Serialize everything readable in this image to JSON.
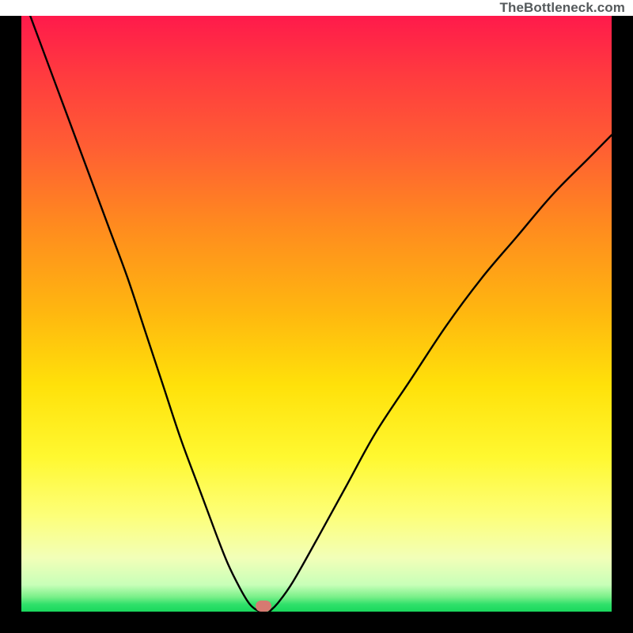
{
  "watermark": "TheBottleneck.com",
  "colors": {
    "frame": "#000000",
    "curve": "#000000",
    "marker": "#d67a71"
  },
  "chart_data": {
    "type": "line",
    "title": "",
    "xlabel": "",
    "ylabel": "",
    "xlim": [
      0,
      100
    ],
    "ylim": [
      0,
      100
    ],
    "grid": false,
    "legend": false,
    "series": [
      {
        "name": "bottleneck-curve-left",
        "x": [
          0,
          3,
          6,
          9,
          12,
          15,
          18,
          21,
          24,
          27,
          30,
          33,
          35,
          37,
          38.5,
          39.5,
          40.5
        ],
        "y": [
          104,
          96,
          88,
          80,
          72,
          64,
          56,
          47,
          38,
          29,
          21,
          13,
          8,
          4,
          1.5,
          0.5,
          0
        ]
      },
      {
        "name": "bottleneck-curve-right",
        "x": [
          42,
          43.5,
          46,
          50,
          55,
          60,
          66,
          72,
          78,
          84,
          90,
          96,
          100
        ],
        "y": [
          0,
          1.5,
          5,
          12,
          21,
          30,
          39,
          48,
          56,
          63,
          70,
          76,
          80
        ]
      }
    ],
    "annotations": [
      {
        "type": "marker",
        "x": 41,
        "y": 0.9,
        "label": "optimal-point"
      }
    ]
  }
}
